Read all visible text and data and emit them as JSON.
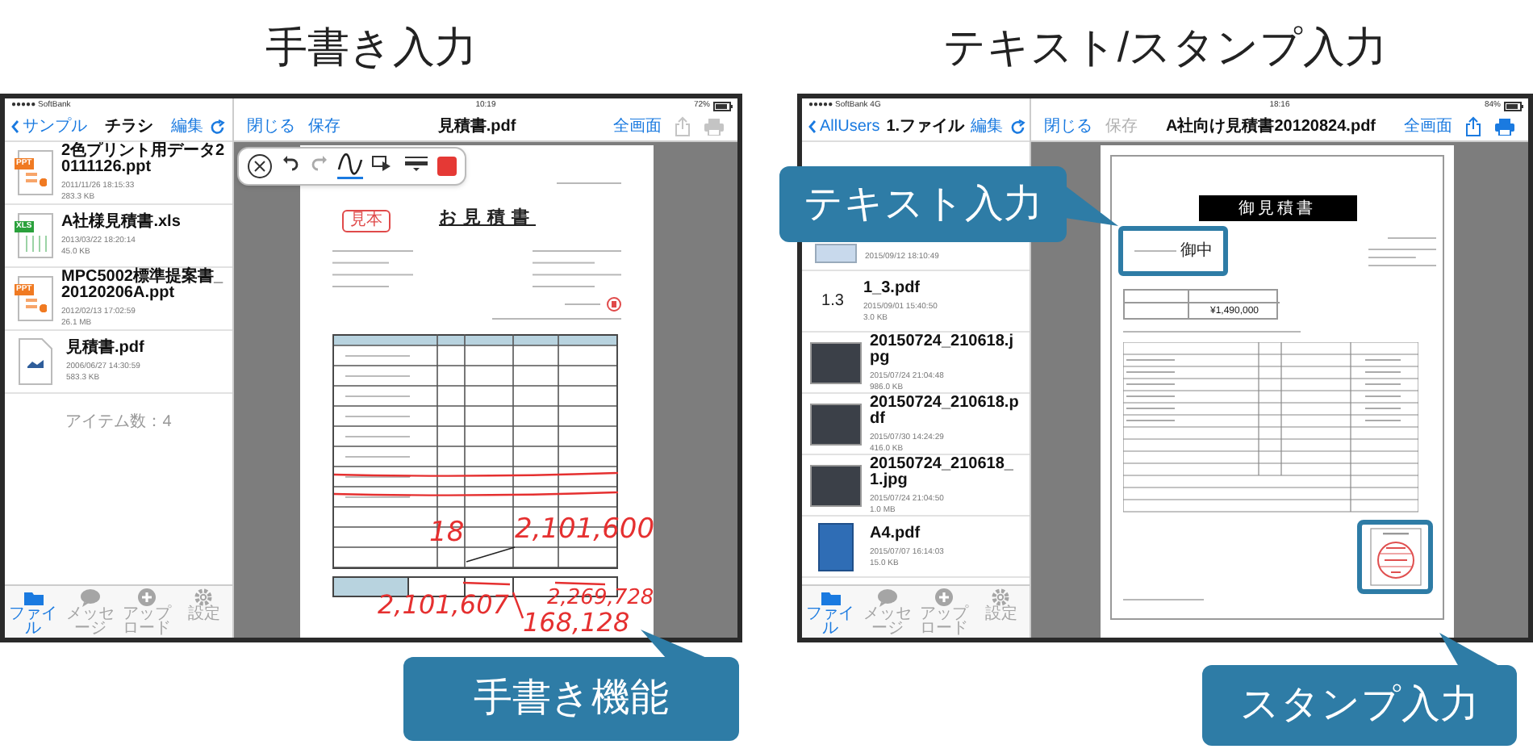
{
  "panels": [
    {
      "heading": "手書き入力",
      "status_bar": {
        "carrier": "●●●●● SoftBank",
        "time": "10:19",
        "battery": "72%"
      },
      "sidebar": {
        "back": "サンプル",
        "title": "チラシ",
        "edit": "編集",
        "files": [
          {
            "kind": "ppt",
            "badge": "PPT",
            "name": "2色プリント用データ20111126.ppt",
            "date": "2011/11/26 18:15:33",
            "size": "283.3 KB"
          },
          {
            "kind": "xls",
            "badge": "XLS",
            "name": "A社様見積書.xls",
            "date": "2013/03/22 18:20:14",
            "size": "45.0 KB"
          },
          {
            "kind": "ppt",
            "badge": "PPT",
            "name": "MPC5002標準提案書_20120206A.ppt",
            "date": "2012/02/13 17:02:59",
            "size": "26.1 MB"
          },
          {
            "kind": "pdf",
            "name": "見積書.pdf",
            "date": "2006/06/27 14:30:59",
            "size": "583.3 KB"
          }
        ],
        "footer": "アイテム数：4",
        "tabs": [
          {
            "label": "ファイル",
            "selected": true
          },
          {
            "label": "メッセージ",
            "selected": false
          },
          {
            "label": "アップロード",
            "selected": false
          },
          {
            "label": "設定",
            "selected": false
          }
        ]
      },
      "viewer": {
        "close": "閉じる",
        "save": "保存",
        "save_enabled": true,
        "title": "見積書.pdf",
        "fullscreen": "全画面",
        "actions_enabled": false,
        "toolbar": [
          {
            "kind": "close",
            "selected": false
          },
          {
            "kind": "undo",
            "selected": false
          },
          {
            "kind": "redo",
            "selected": false
          },
          {
            "kind": "pen",
            "selected": true
          },
          {
            "kind": "eraser",
            "selected": false
          },
          {
            "kind": "width",
            "selected": false
          },
          {
            "kind": "color",
            "selected": false,
            "color": "#e53935"
          }
        ],
        "document": {
          "kind": "handwritten",
          "stamp": "見本",
          "title": "お見積書",
          "handwriting": [
            "18",
            "2,101,600",
            "2,101,607",
            "2,269,728",
            "168,128"
          ]
        }
      },
      "callouts": [
        {
          "kind": "handwriting",
          "text": "手書き機能"
        }
      ]
    },
    {
      "heading": "テキスト/スタンプ入力",
      "status_bar": {
        "carrier": "●●●●● SoftBank 4G",
        "time": "18:16",
        "battery": "84%"
      },
      "sidebar": {
        "back": "AllUsers",
        "title": "1.ファイル",
        "edit": "編集",
        "files": [
          {
            "kind": "partial",
            "date": "2015/09/12 18:10:49"
          },
          {
            "kind": "number",
            "badge": "1.3",
            "name": "1_3.pdf",
            "date": "2015/09/01 15:40:50",
            "size": "3.0 KB"
          },
          {
            "kind": "photo",
            "name": "20150724_210618.jpg",
            "date": "2015/07/24 21:04:48",
            "size": "986.0 KB"
          },
          {
            "kind": "photo",
            "name": "20150724_210618.pdf",
            "date": "2015/07/30 14:24:29",
            "size": "416.0 KB"
          },
          {
            "kind": "photo",
            "name": "20150724_210618_1.jpg",
            "date": "2015/07/24 21:04:50",
            "size": "1.0 MB"
          },
          {
            "kind": "blue",
            "name": "A4.pdf",
            "date": "2015/07/07 16:14:03",
            "size": "15.0 KB"
          }
        ],
        "tabs": [
          {
            "label": "ファイル",
            "selected": true
          },
          {
            "label": "メッセージ",
            "selected": false
          },
          {
            "label": "アップロード",
            "selected": false
          },
          {
            "label": "設定",
            "selected": false
          }
        ]
      },
      "viewer": {
        "close": "閉じる",
        "save": "保存",
        "save_enabled": false,
        "title": "A社向け見積書20120824.pdf",
        "fullscreen": "全画面",
        "actions_enabled": true,
        "document": {
          "kind": "stamped",
          "title": "御見積書",
          "addressee": "御中",
          "amount": "¥1,490,000"
        }
      },
      "callouts": [
        {
          "kind": "text",
          "text": "テキスト入力"
        },
        {
          "kind": "stamp",
          "text": "スタンプ入力"
        }
      ]
    }
  ]
}
